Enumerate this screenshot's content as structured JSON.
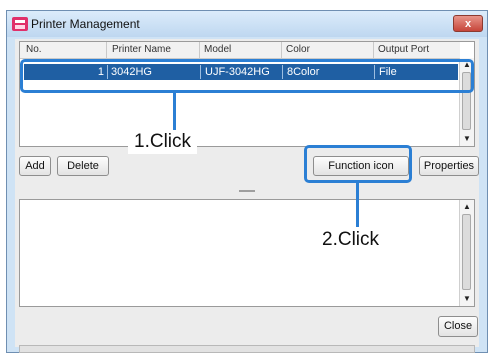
{
  "window": {
    "title": "Printer Management",
    "close_glyph": "x"
  },
  "table": {
    "columns": [
      "No.",
      "Printer Name",
      "Model",
      "Color",
      "Output Port"
    ],
    "rows": [
      {
        "no": "1",
        "printer_name": "3042HG",
        "model": "UJF-3042HG",
        "color": "8Color",
        "output_port": "File"
      }
    ]
  },
  "buttons": {
    "add": "Add",
    "delete": "Delete",
    "function_icon": "Function icon",
    "properties": "Properties",
    "close": "Close"
  },
  "callouts": {
    "step1": "1.Click",
    "step2": "2.Click"
  },
  "colors": {
    "selection": "#1f5fa3",
    "callout": "#2b7fd4",
    "title_bar": "#cfe3f5"
  },
  "icons": {
    "app": "printer-management-icon",
    "close": "close-icon",
    "scroll_up": "scroll-up-arrow-icon",
    "scroll_down": "scroll-down-arrow-icon"
  }
}
